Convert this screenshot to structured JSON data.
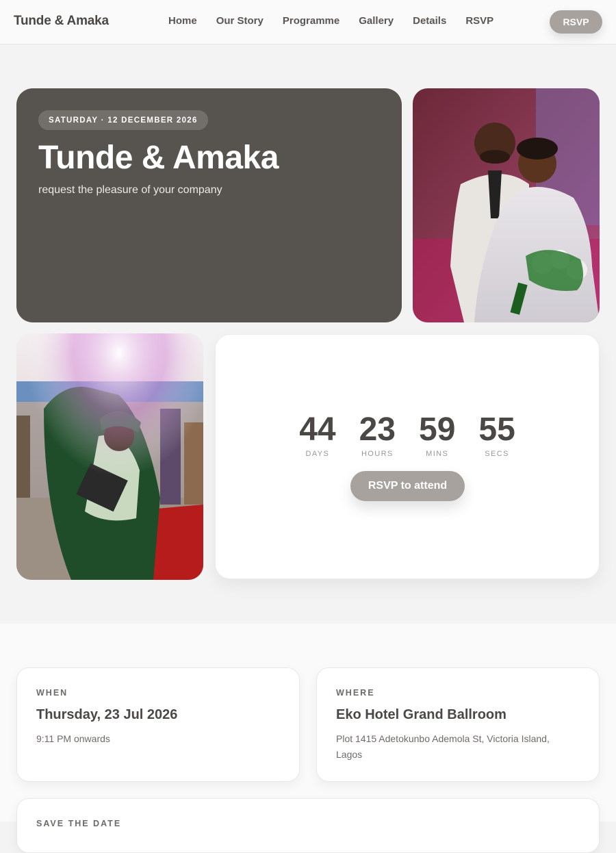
{
  "nav": {
    "brand": "Tunde & Amaka",
    "links": [
      "Home",
      "Our Story",
      "Programme",
      "Gallery",
      "Details",
      "RSVP"
    ],
    "rsvp_button": "RSVP"
  },
  "hero": {
    "date_pill": "SATURDAY · 12 DECEMBER 2026",
    "title": "Tunde & Amaka",
    "subtitle": "request the pleasure of your company"
  },
  "countdown": {
    "units": [
      {
        "value": "44",
        "label": "DAYS"
      },
      {
        "value": "23",
        "label": "HOURS"
      },
      {
        "value": "59",
        "label": "MINS"
      },
      {
        "value": "55",
        "label": "SECS"
      }
    ],
    "button": "RSVP to attend"
  },
  "when": {
    "eyebrow": "WHEN",
    "title": "Thursday, 23 Jul 2026",
    "text": "9:11 PM onwards"
  },
  "where": {
    "eyebrow": "WHERE",
    "title": "Eko Hotel Grand Ballroom",
    "text": "Plot 1415 Adetokunbo Ademola St, Victoria Island, Lagos"
  },
  "save_the_date": {
    "eyebrow": "SAVE THE DATE"
  },
  "colors": {
    "hero_bg": "#57534e",
    "accent_button": "#a8a29e"
  }
}
